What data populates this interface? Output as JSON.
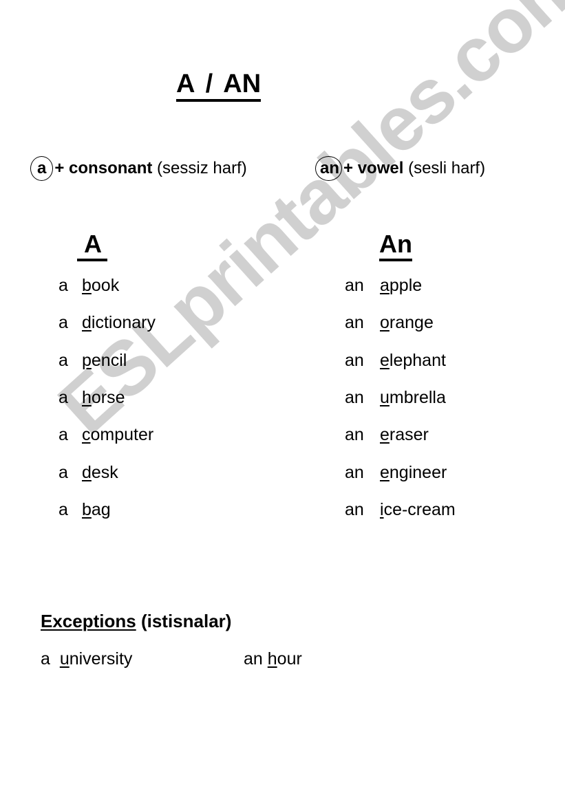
{
  "title": "A  /  AN",
  "rules": [
    {
      "article": "a",
      "plus": "+ ",
      "term": "consonant",
      "translation": " (sessiz harf)"
    },
    {
      "article": "an",
      "plus": "+ ",
      "term": "vowel",
      "translation": " (sesli harf)"
    }
  ],
  "columns": [
    {
      "heading": "A",
      "article": "a",
      "words": [
        {
          "first": "b",
          "rest": "ook"
        },
        {
          "first": "d",
          "rest": "ictionary"
        },
        {
          "first": "p",
          "rest": "encil"
        },
        {
          "first": "h",
          "rest": "orse"
        },
        {
          "first": "c",
          "rest": "omputer"
        },
        {
          "first": "d",
          "rest": "esk"
        },
        {
          "first": "b",
          "rest": "ag"
        }
      ]
    },
    {
      "heading": "An",
      "article": "an",
      "words": [
        {
          "first": "a",
          "rest": "pple"
        },
        {
          "first": "o",
          "rest": "range"
        },
        {
          "first": "e",
          "rest": "lephant"
        },
        {
          "first": "u",
          "rest": "mbrella"
        },
        {
          "first": "e",
          "rest": "raser"
        },
        {
          "first": "e",
          "rest": "ngineer"
        },
        {
          "first": "i",
          "rest": "ce-cream"
        }
      ]
    }
  ],
  "exceptions": {
    "heading": "Exceptions",
    "translation": " (istisnalar)",
    "items": [
      {
        "article": "a",
        "first": "u",
        "rest": "niversity"
      },
      {
        "article": "an",
        "first": "h",
        "rest": "our"
      }
    ]
  },
  "watermark": "ESLprintables.com"
}
